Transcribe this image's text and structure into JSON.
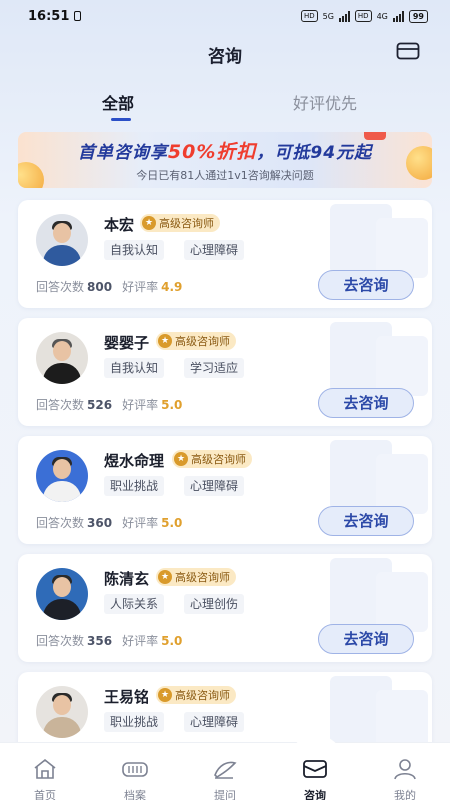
{
  "status": {
    "time": "16:51",
    "hd1": "HD",
    "net1": "5G",
    "hd2": "HD",
    "net2": "4G",
    "battery": "99"
  },
  "header": {
    "title": "咨询",
    "icon": "message-box-icon"
  },
  "tabs": [
    {
      "label": "全部",
      "active": true
    },
    {
      "label": "好评优先",
      "active": false
    }
  ],
  "banner": {
    "headline_prefix": "首单咨询享",
    "headline_highlight": "50%折扣",
    "headline_suffix": "，可抵94元起",
    "subtext": "今日已有81人通过1v1咨询解决问题"
  },
  "labels": {
    "answers": "回答次数",
    "rating": "好评率",
    "consult_button": "去咨询",
    "badge": "高级咨询师"
  },
  "counselors": [
    {
      "name": "本宏",
      "tags": [
        "自我认知",
        "心理障碍"
      ],
      "answers": "800",
      "rating": "4.9"
    },
    {
      "name": "婴婴子",
      "tags": [
        "自我认知",
        "学习适应"
      ],
      "answers": "526",
      "rating": "5.0"
    },
    {
      "name": "煜水命理",
      "tags": [
        "职业挑战",
        "心理障碍"
      ],
      "answers": "360",
      "rating": "5.0"
    },
    {
      "name": "陈清玄",
      "tags": [
        "人际关系",
        "心理创伤"
      ],
      "answers": "356",
      "rating": "5.0"
    },
    {
      "name": "王易铭",
      "tags": [
        "职业挑战",
        "心理障碍"
      ],
      "answers": "",
      "rating": ""
    }
  ],
  "tabbar": [
    {
      "label": "首页",
      "icon": "home-icon"
    },
    {
      "label": "档案",
      "icon": "archive-icon"
    },
    {
      "label": "提问",
      "icon": "ask-icon"
    },
    {
      "label": "咨询",
      "icon": "consult-icon",
      "active": true
    },
    {
      "label": "我的",
      "icon": "profile-icon"
    }
  ],
  "colors": {
    "accent": "#2b4fc7",
    "highlight": "#ef3d2e",
    "badge_bg": "#fbe9c4",
    "rating": "#e0a02e"
  }
}
